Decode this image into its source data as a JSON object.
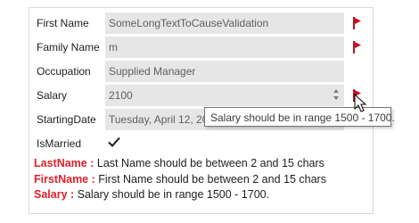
{
  "form": {
    "fields": [
      {
        "label": "First Name",
        "value": "SomeLongTextToCauseValidation"
      },
      {
        "label": "Family Name",
        "value": "m"
      },
      {
        "label": "Occupation",
        "value": "Supplied Manager"
      },
      {
        "label": "Salary",
        "value": "2100"
      },
      {
        "label": "StartingDate",
        "value": "Tuesday, April 12, 20"
      }
    ],
    "is_married_label": "IsMarried",
    "is_married_checked": true
  },
  "errors": [
    {
      "field": "LastName :",
      "message": " Last Name should be between 2 and 15 chars"
    },
    {
      "field": "FirstName :",
      "message": " First Name should be between 2 and 15 chars"
    },
    {
      "field": "Salary :",
      "message": " Salary should be in range 1500 - 1700."
    }
  ],
  "tooltip": {
    "text": "Salary should be in range 1500 - 1700."
  },
  "icons": {
    "error_flag": "error-flag-icon",
    "checkmark": "checkmark-icon",
    "cursor": "mouse-pointer-icon",
    "spinner": "spinner-icon"
  },
  "colors": {
    "error_red": "#e0202b",
    "flag_red": "#c0121e",
    "field_bg": "#e6e6e6"
  }
}
